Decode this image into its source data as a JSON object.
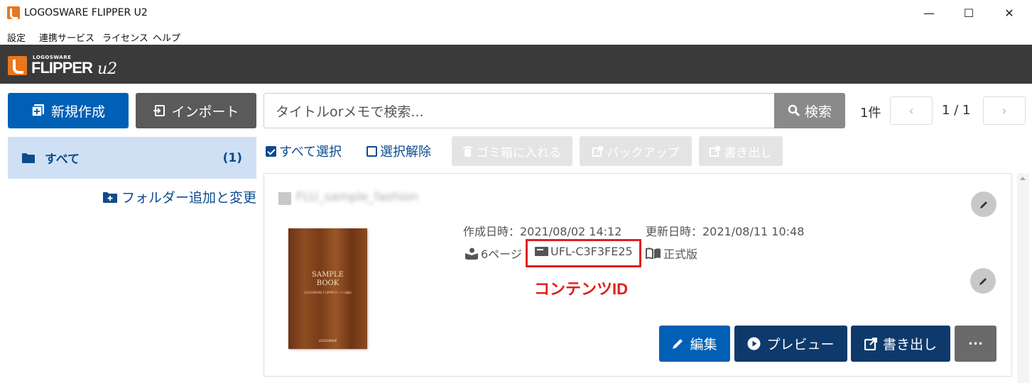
{
  "window": {
    "title": "LOGOSWARE FLIPPER U2",
    "minimize": "—",
    "maximize": "☐",
    "close": "✕"
  },
  "menu": [
    "設定",
    "連携サービス",
    "ライセンス",
    "ヘルプ"
  ],
  "logo": {
    "small": "LOGOSWARE",
    "big": "FLIPPER",
    "version": "u2"
  },
  "toolbar": {
    "new_label": "新規作成",
    "import_label": "インポート",
    "search_placeholder": "タイトルorメモで検索...",
    "search_button": "検索",
    "count": "1件",
    "prev": "‹",
    "next": "›",
    "page": "1 / 1"
  },
  "sidebar": {
    "all_label": "すべて",
    "all_count": "(1)",
    "folder_add": "フォルダー追加と変更"
  },
  "selection": {
    "select_all": "すべて選択",
    "deselect": "選択解除",
    "trash": "ゴミ箱に入れる",
    "backup": "バックアップ",
    "export": "書き出し"
  },
  "item": {
    "title": "FLU_sample_fashion",
    "created": "作成日時：2021/08/02 14:12",
    "updated": "更新日時：2021/08/11 10:48",
    "pages": "6ページ",
    "content_id": "UFL-C3F3FE25",
    "edition": "正式版",
    "cover_title_1": "SAMPLE",
    "cover_title_2": "BOOK",
    "cover_subtitle": "LOGOSWARE FLIPPERサンプル資料",
    "cover_footer": "LOGOSWARE"
  },
  "annotation": "コンテンツID",
  "actions": {
    "edit": "編集",
    "preview": "プレビュー",
    "export": "書き出し",
    "more": "•••"
  },
  "colors": {
    "primary": "#0060b6",
    "dark_blue": "#0d3a6b",
    "header": "#3a3a3a",
    "highlight": "#e02020"
  }
}
